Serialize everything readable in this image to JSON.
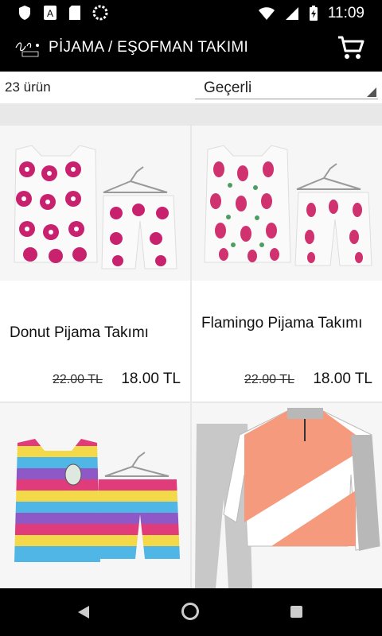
{
  "status": {
    "time": "11:09"
  },
  "app_bar": {
    "title": "PİJAMA / EŞOFMAN TAKIMI",
    "logo_icon": "butik-logo",
    "cart_icon": "cart-icon"
  },
  "toolbar": {
    "count": "23 ürün",
    "sort_selected": "Geçerli"
  },
  "products": [
    {
      "name": "Donut Pijama Takımı",
      "old_price": "22.00 TL",
      "new_price": "18.00 TL",
      "print_color": "#c8226f"
    },
    {
      "name": "Flamingo Pijama Takımı",
      "old_price": "22.00 TL",
      "new_price": "18.00 TL",
      "print_color": "#d0316f"
    },
    {
      "name": "",
      "colors": [
        "#e03b7b",
        "#f3d84a",
        "#4fb6e6",
        "#8e59c6"
      ]
    },
    {
      "name": "",
      "colors": [
        "#f59a7c",
        "#ffffff",
        "#b8b8b8"
      ]
    }
  ],
  "colors": {
    "bars": "#000000",
    "background": "#e8e8e8"
  }
}
